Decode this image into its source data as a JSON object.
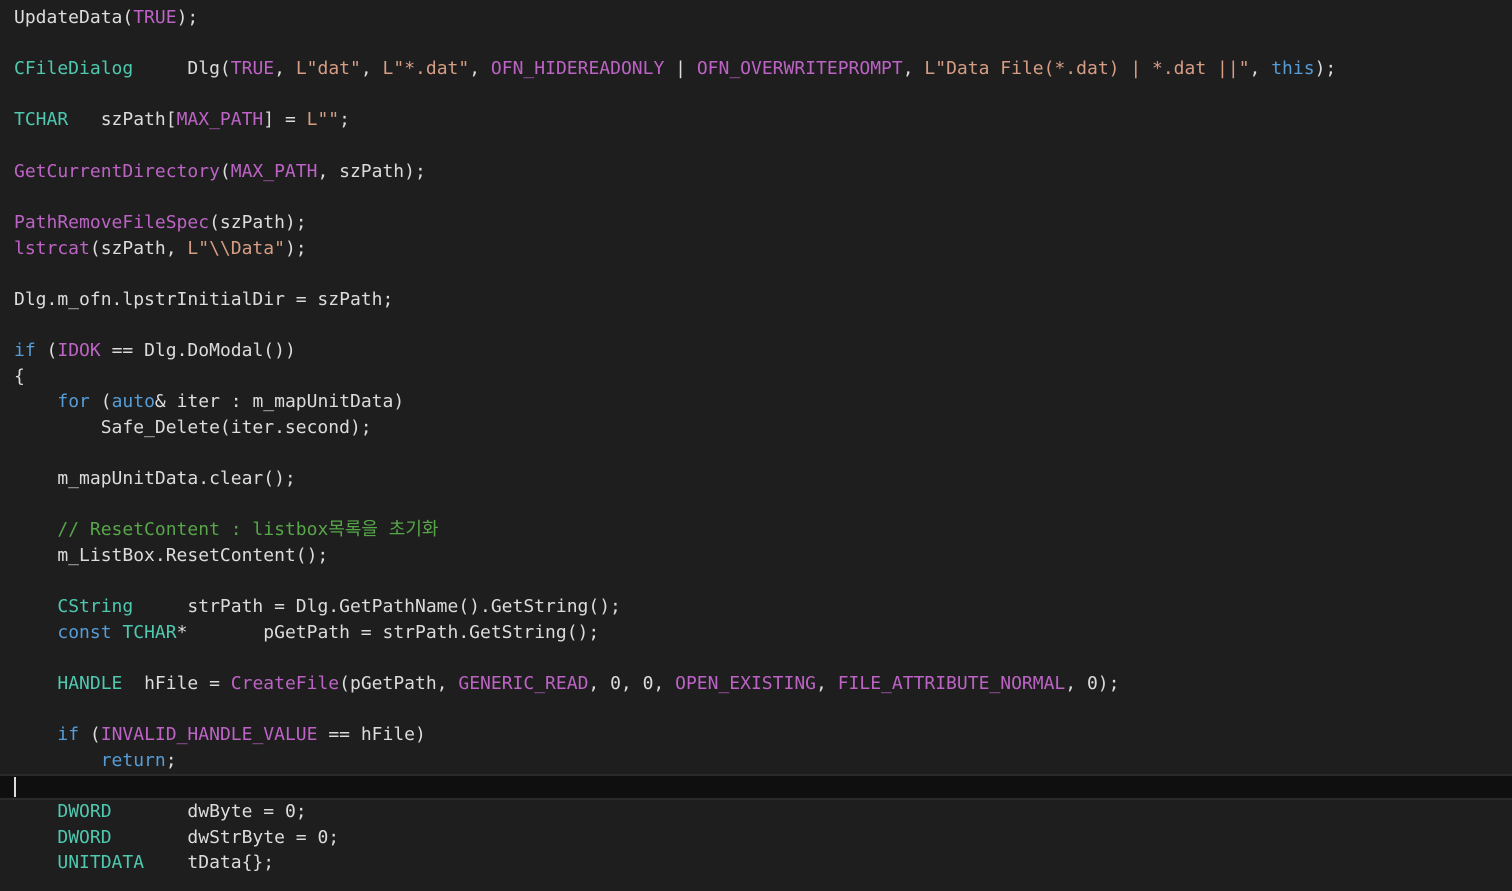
{
  "editor": {
    "colors": {
      "background": "#1e1e1e",
      "current_line": "#0f0f0f",
      "keyword": "#569cd6",
      "type": "#4ec9b0",
      "macro": "#bd63c5",
      "string": "#d69d85",
      "comment": "#57a64a",
      "default": "#dcdcdc"
    },
    "current_line_index": 30,
    "lines": [
      [
        [
          "n",
          "UpdateData("
        ],
        [
          "m",
          "TRUE"
        ],
        [
          "n",
          ");"
        ]
      ],
      [],
      [
        [
          "t",
          "CFileDialog"
        ],
        [
          "n",
          "     Dlg("
        ],
        [
          "m",
          "TRUE"
        ],
        [
          "n",
          ", "
        ],
        [
          "s",
          "L\"dat\""
        ],
        [
          "n",
          ", "
        ],
        [
          "s",
          "L\"*.dat\""
        ],
        [
          "n",
          ", "
        ],
        [
          "m",
          "OFN_HIDEREADONLY"
        ],
        [
          "n",
          " | "
        ],
        [
          "m",
          "OFN_OVERWRITEPROMPT"
        ],
        [
          "n",
          ", "
        ],
        [
          "s",
          "L\"Data File(*.dat) | *.dat ||\""
        ],
        [
          "n",
          ", "
        ],
        [
          "k",
          "this"
        ],
        [
          "n",
          ");"
        ]
      ],
      [],
      [
        [
          "t",
          "TCHAR"
        ],
        [
          "n",
          "   szPath["
        ],
        [
          "m",
          "MAX_PATH"
        ],
        [
          "n",
          "] = "
        ],
        [
          "s",
          "L\"\""
        ],
        [
          "n",
          ";"
        ]
      ],
      [],
      [
        [
          "f",
          "GetCurrentDirectory"
        ],
        [
          "n",
          "("
        ],
        [
          "m",
          "MAX_PATH"
        ],
        [
          "n",
          ", szPath);"
        ]
      ],
      [],
      [
        [
          "f",
          "PathRemoveFileSpec"
        ],
        [
          "n",
          "(szPath);"
        ]
      ],
      [
        [
          "f",
          "lstrcat"
        ],
        [
          "n",
          "(szPath, "
        ],
        [
          "s",
          "L\"\\\\Data\""
        ],
        [
          "n",
          ");"
        ]
      ],
      [],
      [
        [
          "n",
          "Dlg.m_ofn.lpstrInitialDir = szPath;"
        ]
      ],
      [],
      [
        [
          "k",
          "if"
        ],
        [
          "n",
          " ("
        ],
        [
          "m",
          "IDOK"
        ],
        [
          "n",
          " == Dlg.DoModal())"
        ]
      ],
      [
        [
          "n",
          "{"
        ]
      ],
      [
        [
          "n",
          "    "
        ],
        [
          "k",
          "for"
        ],
        [
          "n",
          " ("
        ],
        [
          "k",
          "auto"
        ],
        [
          "n",
          "& iter : m_mapUnitData)"
        ]
      ],
      [
        [
          "n",
          "        Safe_Delete(iter.second);"
        ]
      ],
      [],
      [
        [
          "n",
          "    m_mapUnitData.clear();"
        ]
      ],
      [],
      [
        [
          "n",
          "    "
        ],
        [
          "c",
          "// ResetContent : listbox목록을 초기화"
        ]
      ],
      [
        [
          "n",
          "    m_ListBox.ResetContent();"
        ]
      ],
      [],
      [
        [
          "n",
          "    "
        ],
        [
          "t",
          "CString"
        ],
        [
          "n",
          "     strPath = Dlg.GetPathName().GetString();"
        ]
      ],
      [
        [
          "n",
          "    "
        ],
        [
          "k",
          "const"
        ],
        [
          "n",
          " "
        ],
        [
          "t",
          "TCHAR"
        ],
        [
          "n",
          "*       pGetPath = strPath.GetString();"
        ]
      ],
      [],
      [
        [
          "n",
          "    "
        ],
        [
          "t",
          "HANDLE"
        ],
        [
          "n",
          "  hFile = "
        ],
        [
          "f",
          "CreateFile"
        ],
        [
          "n",
          "(pGetPath, "
        ],
        [
          "m",
          "GENERIC_READ"
        ],
        [
          "n",
          ", 0, 0, "
        ],
        [
          "m",
          "OPEN_EXISTING"
        ],
        [
          "n",
          ", "
        ],
        [
          "m",
          "FILE_ATTRIBUTE_NORMAL"
        ],
        [
          "n",
          ", 0);"
        ]
      ],
      [],
      [
        [
          "n",
          "    "
        ],
        [
          "k",
          "if"
        ],
        [
          "n",
          " ("
        ],
        [
          "m",
          "INVALID_HANDLE_VALUE"
        ],
        [
          "n",
          " == hFile)"
        ]
      ],
      [
        [
          "n",
          "        "
        ],
        [
          "k",
          "return"
        ],
        [
          "n",
          ";"
        ]
      ],
      [],
      [
        [
          "n",
          "    "
        ],
        [
          "t",
          "DWORD"
        ],
        [
          "n",
          "       dwByte = 0;"
        ]
      ],
      [
        [
          "n",
          "    "
        ],
        [
          "t",
          "DWORD"
        ],
        [
          "n",
          "       dwStrByte = 0;"
        ]
      ],
      [
        [
          "n",
          "    "
        ],
        [
          "t",
          "UNITDATA"
        ],
        [
          "n",
          "    tData{};"
        ]
      ]
    ]
  }
}
